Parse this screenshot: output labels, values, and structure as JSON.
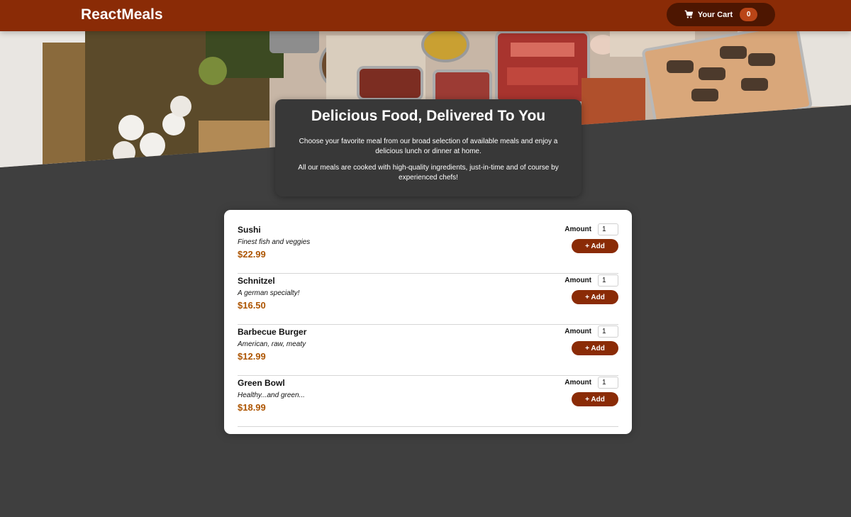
{
  "header": {
    "brand": "ReactMeals",
    "cart": {
      "icon": "cart-icon",
      "label": "Your Cart",
      "count": "0"
    }
  },
  "summary": {
    "title": "Delicious Food, Delivered To You",
    "paragraph1": "Choose your favorite meal from our broad selection of available meals and enjoy a delicious lunch or dinner at home.",
    "paragraph2": "All our meals are cooked with high-quality ingredients, just-in-time and of course by experienced chefs!"
  },
  "meals": [
    {
      "name": "Sushi",
      "description": "Finest fish and veggies",
      "price": "$22.99",
      "amount_label": "Amount",
      "amount": "1",
      "add_label": "+ Add"
    },
    {
      "name": "Schnitzel",
      "description": "A german specialty!",
      "price": "$16.50",
      "amount_label": "Amount",
      "amount": "1",
      "add_label": "+ Add"
    },
    {
      "name": "Barbecue Burger",
      "description": "American, raw, meaty",
      "price": "$12.99",
      "amount_label": "Amount",
      "amount": "1",
      "add_label": "+ Add"
    },
    {
      "name": "Green Bowl",
      "description": "Healthy...and green...",
      "price": "$18.99",
      "amount_label": "Amount",
      "amount": "1",
      "add_label": "+ Add"
    }
  ],
  "colors": {
    "header": "#8a2b06",
    "cart_button": "#4d1601",
    "badge": "#b94517",
    "price": "#ad5502",
    "background": "#3f3f3f"
  }
}
